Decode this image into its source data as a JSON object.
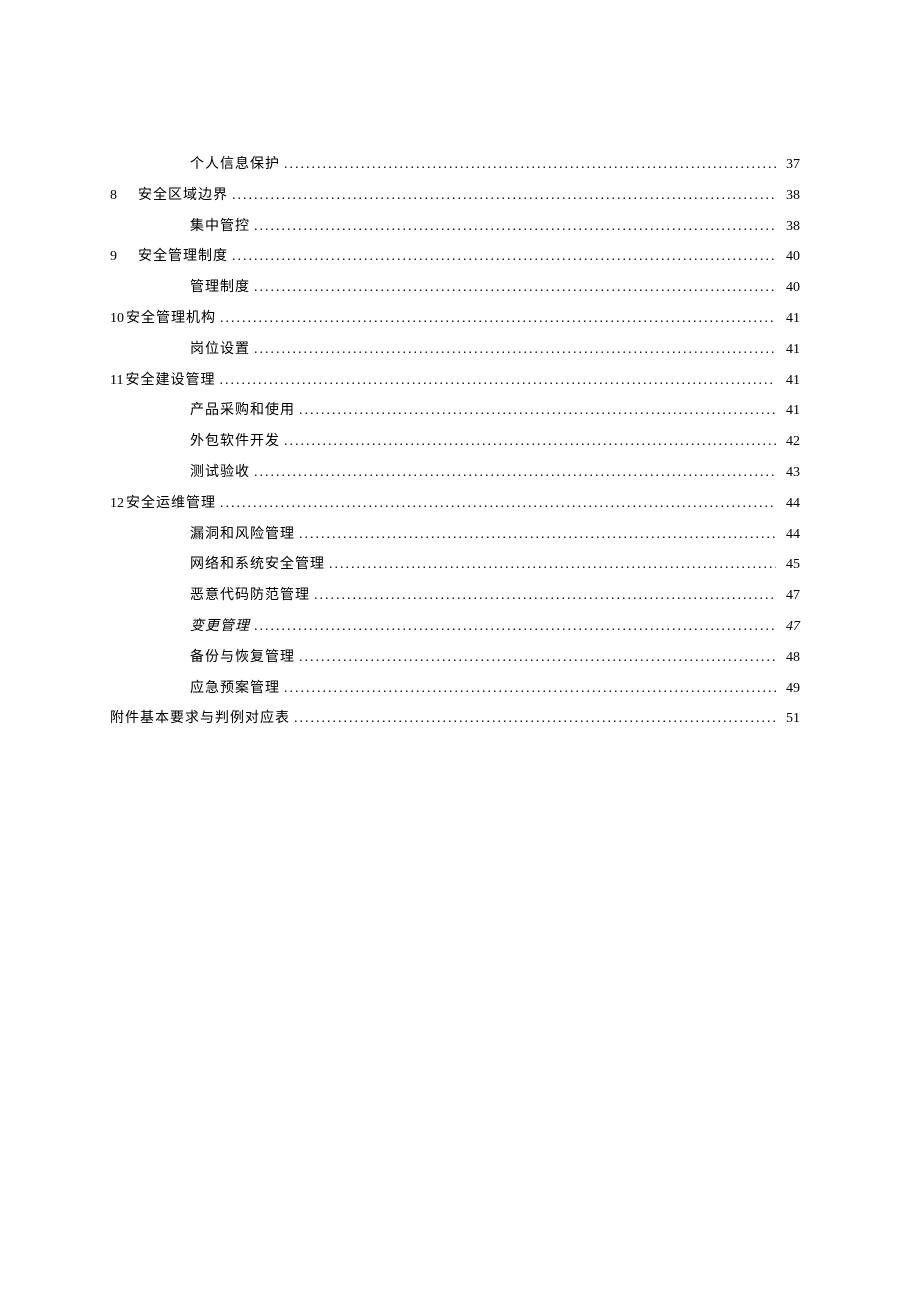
{
  "toc": [
    {
      "level": 2,
      "num": "",
      "label": "个人信息保护",
      "page": "37",
      "italic": false
    },
    {
      "level": 1,
      "num": "8",
      "label": "安全区域边界",
      "page": "38",
      "italic": false
    },
    {
      "level": 2,
      "num": "",
      "label": "集中管控",
      "page": "38",
      "italic": false
    },
    {
      "level": 1,
      "num": "9",
      "label": "安全管理制度",
      "page": "40",
      "italic": false
    },
    {
      "level": 2,
      "num": "",
      "label": "管理制度",
      "page": "40",
      "italic": false
    },
    {
      "level": 1,
      "num": "10",
      "label": "安全管理机构",
      "page": "41",
      "italic": false
    },
    {
      "level": 2,
      "num": "",
      "label": "岗位设置",
      "page": "41",
      "italic": false
    },
    {
      "level": 1,
      "num": "11",
      "label": "安全建设管理",
      "page": "41",
      "italic": false
    },
    {
      "level": 2,
      "num": "",
      "label": "产品采购和使用",
      "page": "41",
      "italic": false
    },
    {
      "level": 2,
      "num": "",
      "label": "外包软件开发",
      "page": "42",
      "italic": false
    },
    {
      "level": 2,
      "num": "",
      "label": "测试验收",
      "page": "43",
      "italic": false
    },
    {
      "level": 1,
      "num": "12",
      "label": "安全运维管理",
      "page": "44",
      "italic": false
    },
    {
      "level": 2,
      "num": "",
      "label": "漏洞和风险管理",
      "page": "44",
      "italic": false
    },
    {
      "level": 2,
      "num": "",
      "label": "网络和系统安全管理",
      "page": "45",
      "italic": false
    },
    {
      "level": 2,
      "num": "",
      "label": "恶意代码防范管理",
      "page": "47",
      "italic": false
    },
    {
      "level": 2,
      "num": "",
      "label": "变更管理",
      "page": "47",
      "italic": true
    },
    {
      "level": 2,
      "num": "",
      "label": "备份与恢复管理",
      "page": "48",
      "italic": false
    },
    {
      "level": 2,
      "num": "",
      "label": "应急预案管理",
      "page": "49",
      "italic": false
    },
    {
      "level": 0,
      "num": "",
      "label": "附件基本要求与判例对应表",
      "page": "51",
      "italic": false
    }
  ]
}
